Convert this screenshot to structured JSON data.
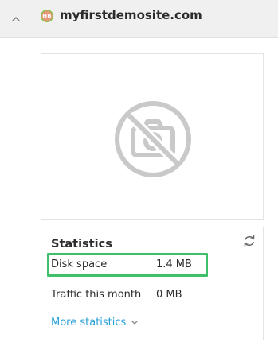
{
  "header": {
    "collapse_icon": "chevron-up-icon",
    "site_badge": "HB",
    "site_name": "myfirstdemosite.com"
  },
  "screenshot": {
    "icon": "no-camera-icon"
  },
  "statistics": {
    "title": "Statistics",
    "refresh_icon": "refresh-icon",
    "rows": [
      {
        "label": "Disk space",
        "value": "1.4 MB",
        "highlighted": true
      },
      {
        "label": "Traffic this month",
        "value": "0 MB",
        "highlighted": false
      }
    ],
    "more_link": "More statistics",
    "more_icon": "chevron-down-icon"
  },
  "colors": {
    "link": "#28a0d8",
    "highlight": "#3fbf6a",
    "badge": "#e8967a"
  }
}
